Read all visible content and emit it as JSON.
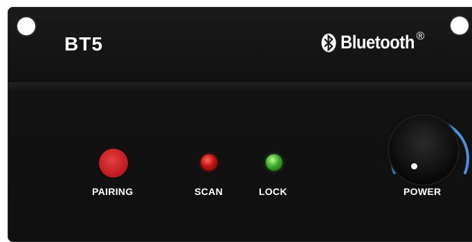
{
  "device": {
    "model": "BT5",
    "brand": {
      "icon": "bluetooth-icon",
      "name": "Bluetooth",
      "registered_mark": "®"
    },
    "controls": {
      "pairing": {
        "label": "PAIRING",
        "color": "#c81f27"
      },
      "scan": {
        "label": "SCAN",
        "led_color": "#c0150f",
        "lit": true
      },
      "lock": {
        "label": "LOCK",
        "led_color": "#3fa92b",
        "lit": true
      },
      "power": {
        "label": "POWER",
        "arc_color": "#4a8fe0"
      }
    },
    "panel_color": "#121212"
  }
}
